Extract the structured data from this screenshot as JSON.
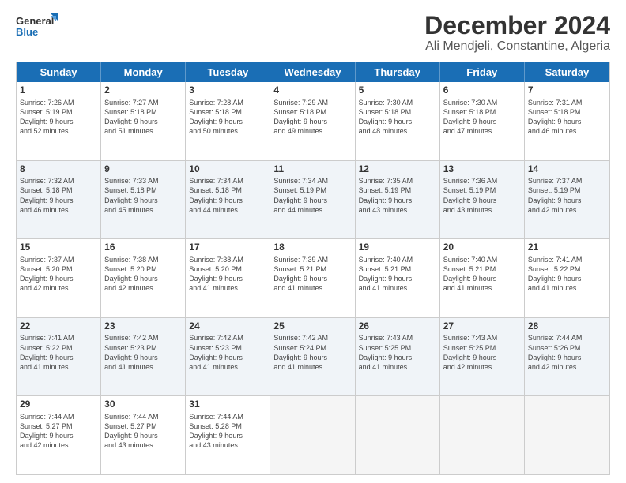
{
  "logo": {
    "line1": "General",
    "line2": "Blue"
  },
  "title": "December 2024",
  "subtitle": "Ali Mendjeli, Constantine, Algeria",
  "header_days": [
    "Sunday",
    "Monday",
    "Tuesday",
    "Wednesday",
    "Thursday",
    "Friday",
    "Saturday"
  ],
  "rows": [
    [
      {
        "day": "1",
        "text": "Sunrise: 7:26 AM\nSunset: 5:19 PM\nDaylight: 9 hours\nand 52 minutes."
      },
      {
        "day": "2",
        "text": "Sunrise: 7:27 AM\nSunset: 5:18 PM\nDaylight: 9 hours\nand 51 minutes."
      },
      {
        "day": "3",
        "text": "Sunrise: 7:28 AM\nSunset: 5:18 PM\nDaylight: 9 hours\nand 50 minutes."
      },
      {
        "day": "4",
        "text": "Sunrise: 7:29 AM\nSunset: 5:18 PM\nDaylight: 9 hours\nand 49 minutes."
      },
      {
        "day": "5",
        "text": "Sunrise: 7:30 AM\nSunset: 5:18 PM\nDaylight: 9 hours\nand 48 minutes."
      },
      {
        "day": "6",
        "text": "Sunrise: 7:30 AM\nSunset: 5:18 PM\nDaylight: 9 hours\nand 47 minutes."
      },
      {
        "day": "7",
        "text": "Sunrise: 7:31 AM\nSunset: 5:18 PM\nDaylight: 9 hours\nand 46 minutes."
      }
    ],
    [
      {
        "day": "8",
        "text": "Sunrise: 7:32 AM\nSunset: 5:18 PM\nDaylight: 9 hours\nand 46 minutes."
      },
      {
        "day": "9",
        "text": "Sunrise: 7:33 AM\nSunset: 5:18 PM\nDaylight: 9 hours\nand 45 minutes."
      },
      {
        "day": "10",
        "text": "Sunrise: 7:34 AM\nSunset: 5:18 PM\nDaylight: 9 hours\nand 44 minutes."
      },
      {
        "day": "11",
        "text": "Sunrise: 7:34 AM\nSunset: 5:19 PM\nDaylight: 9 hours\nand 44 minutes."
      },
      {
        "day": "12",
        "text": "Sunrise: 7:35 AM\nSunset: 5:19 PM\nDaylight: 9 hours\nand 43 minutes."
      },
      {
        "day": "13",
        "text": "Sunrise: 7:36 AM\nSunset: 5:19 PM\nDaylight: 9 hours\nand 43 minutes."
      },
      {
        "day": "14",
        "text": "Sunrise: 7:37 AM\nSunset: 5:19 PM\nDaylight: 9 hours\nand 42 minutes."
      }
    ],
    [
      {
        "day": "15",
        "text": "Sunrise: 7:37 AM\nSunset: 5:20 PM\nDaylight: 9 hours\nand 42 minutes."
      },
      {
        "day": "16",
        "text": "Sunrise: 7:38 AM\nSunset: 5:20 PM\nDaylight: 9 hours\nand 42 minutes."
      },
      {
        "day": "17",
        "text": "Sunrise: 7:38 AM\nSunset: 5:20 PM\nDaylight: 9 hours\nand 41 minutes."
      },
      {
        "day": "18",
        "text": "Sunrise: 7:39 AM\nSunset: 5:21 PM\nDaylight: 9 hours\nand 41 minutes."
      },
      {
        "day": "19",
        "text": "Sunrise: 7:40 AM\nSunset: 5:21 PM\nDaylight: 9 hours\nand 41 minutes."
      },
      {
        "day": "20",
        "text": "Sunrise: 7:40 AM\nSunset: 5:21 PM\nDaylight: 9 hours\nand 41 minutes."
      },
      {
        "day": "21",
        "text": "Sunrise: 7:41 AM\nSunset: 5:22 PM\nDaylight: 9 hours\nand 41 minutes."
      }
    ],
    [
      {
        "day": "22",
        "text": "Sunrise: 7:41 AM\nSunset: 5:22 PM\nDaylight: 9 hours\nand 41 minutes."
      },
      {
        "day": "23",
        "text": "Sunrise: 7:42 AM\nSunset: 5:23 PM\nDaylight: 9 hours\nand 41 minutes."
      },
      {
        "day": "24",
        "text": "Sunrise: 7:42 AM\nSunset: 5:23 PM\nDaylight: 9 hours\nand 41 minutes."
      },
      {
        "day": "25",
        "text": "Sunrise: 7:42 AM\nSunset: 5:24 PM\nDaylight: 9 hours\nand 41 minutes."
      },
      {
        "day": "26",
        "text": "Sunrise: 7:43 AM\nSunset: 5:25 PM\nDaylight: 9 hours\nand 41 minutes."
      },
      {
        "day": "27",
        "text": "Sunrise: 7:43 AM\nSunset: 5:25 PM\nDaylight: 9 hours\nand 42 minutes."
      },
      {
        "day": "28",
        "text": "Sunrise: 7:44 AM\nSunset: 5:26 PM\nDaylight: 9 hours\nand 42 minutes."
      }
    ],
    [
      {
        "day": "29",
        "text": "Sunrise: 7:44 AM\nSunset: 5:27 PM\nDaylight: 9 hours\nand 42 minutes."
      },
      {
        "day": "30",
        "text": "Sunrise: 7:44 AM\nSunset: 5:27 PM\nDaylight: 9 hours\nand 43 minutes."
      },
      {
        "day": "31",
        "text": "Sunrise: 7:44 AM\nSunset: 5:28 PM\nDaylight: 9 hours\nand 43 minutes."
      },
      {
        "day": "",
        "text": ""
      },
      {
        "day": "",
        "text": ""
      },
      {
        "day": "",
        "text": ""
      },
      {
        "day": "",
        "text": ""
      }
    ]
  ]
}
